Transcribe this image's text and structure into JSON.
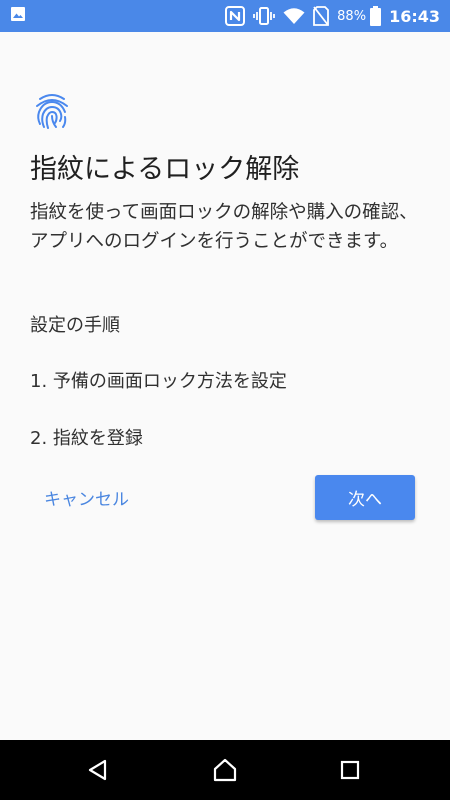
{
  "status_bar": {
    "battery_percent": "88%",
    "time": "16:43",
    "background_color": "#4a88e8",
    "icons": [
      "image-icon",
      "nfc-icon",
      "vibrate-icon",
      "wifi-icon",
      "no-sim-icon",
      "battery-icon"
    ]
  },
  "screen": {
    "icon": "fingerprint-icon",
    "title": "指紋によるロック解除",
    "description": "指紋を使って画面ロックの解除や購入の確認、アプリへのログインを行うことができます。",
    "steps_heading": "設定の手順",
    "steps": [
      "1. 予備の画面ロック方法を設定",
      "2. 指紋を登録"
    ]
  },
  "actions": {
    "cancel_label": "キャンセル",
    "next_label": "次へ",
    "accent_color": "#4a88ee"
  },
  "nav_bar": {
    "icons": [
      "back-icon",
      "home-icon",
      "recents-icon"
    ]
  }
}
